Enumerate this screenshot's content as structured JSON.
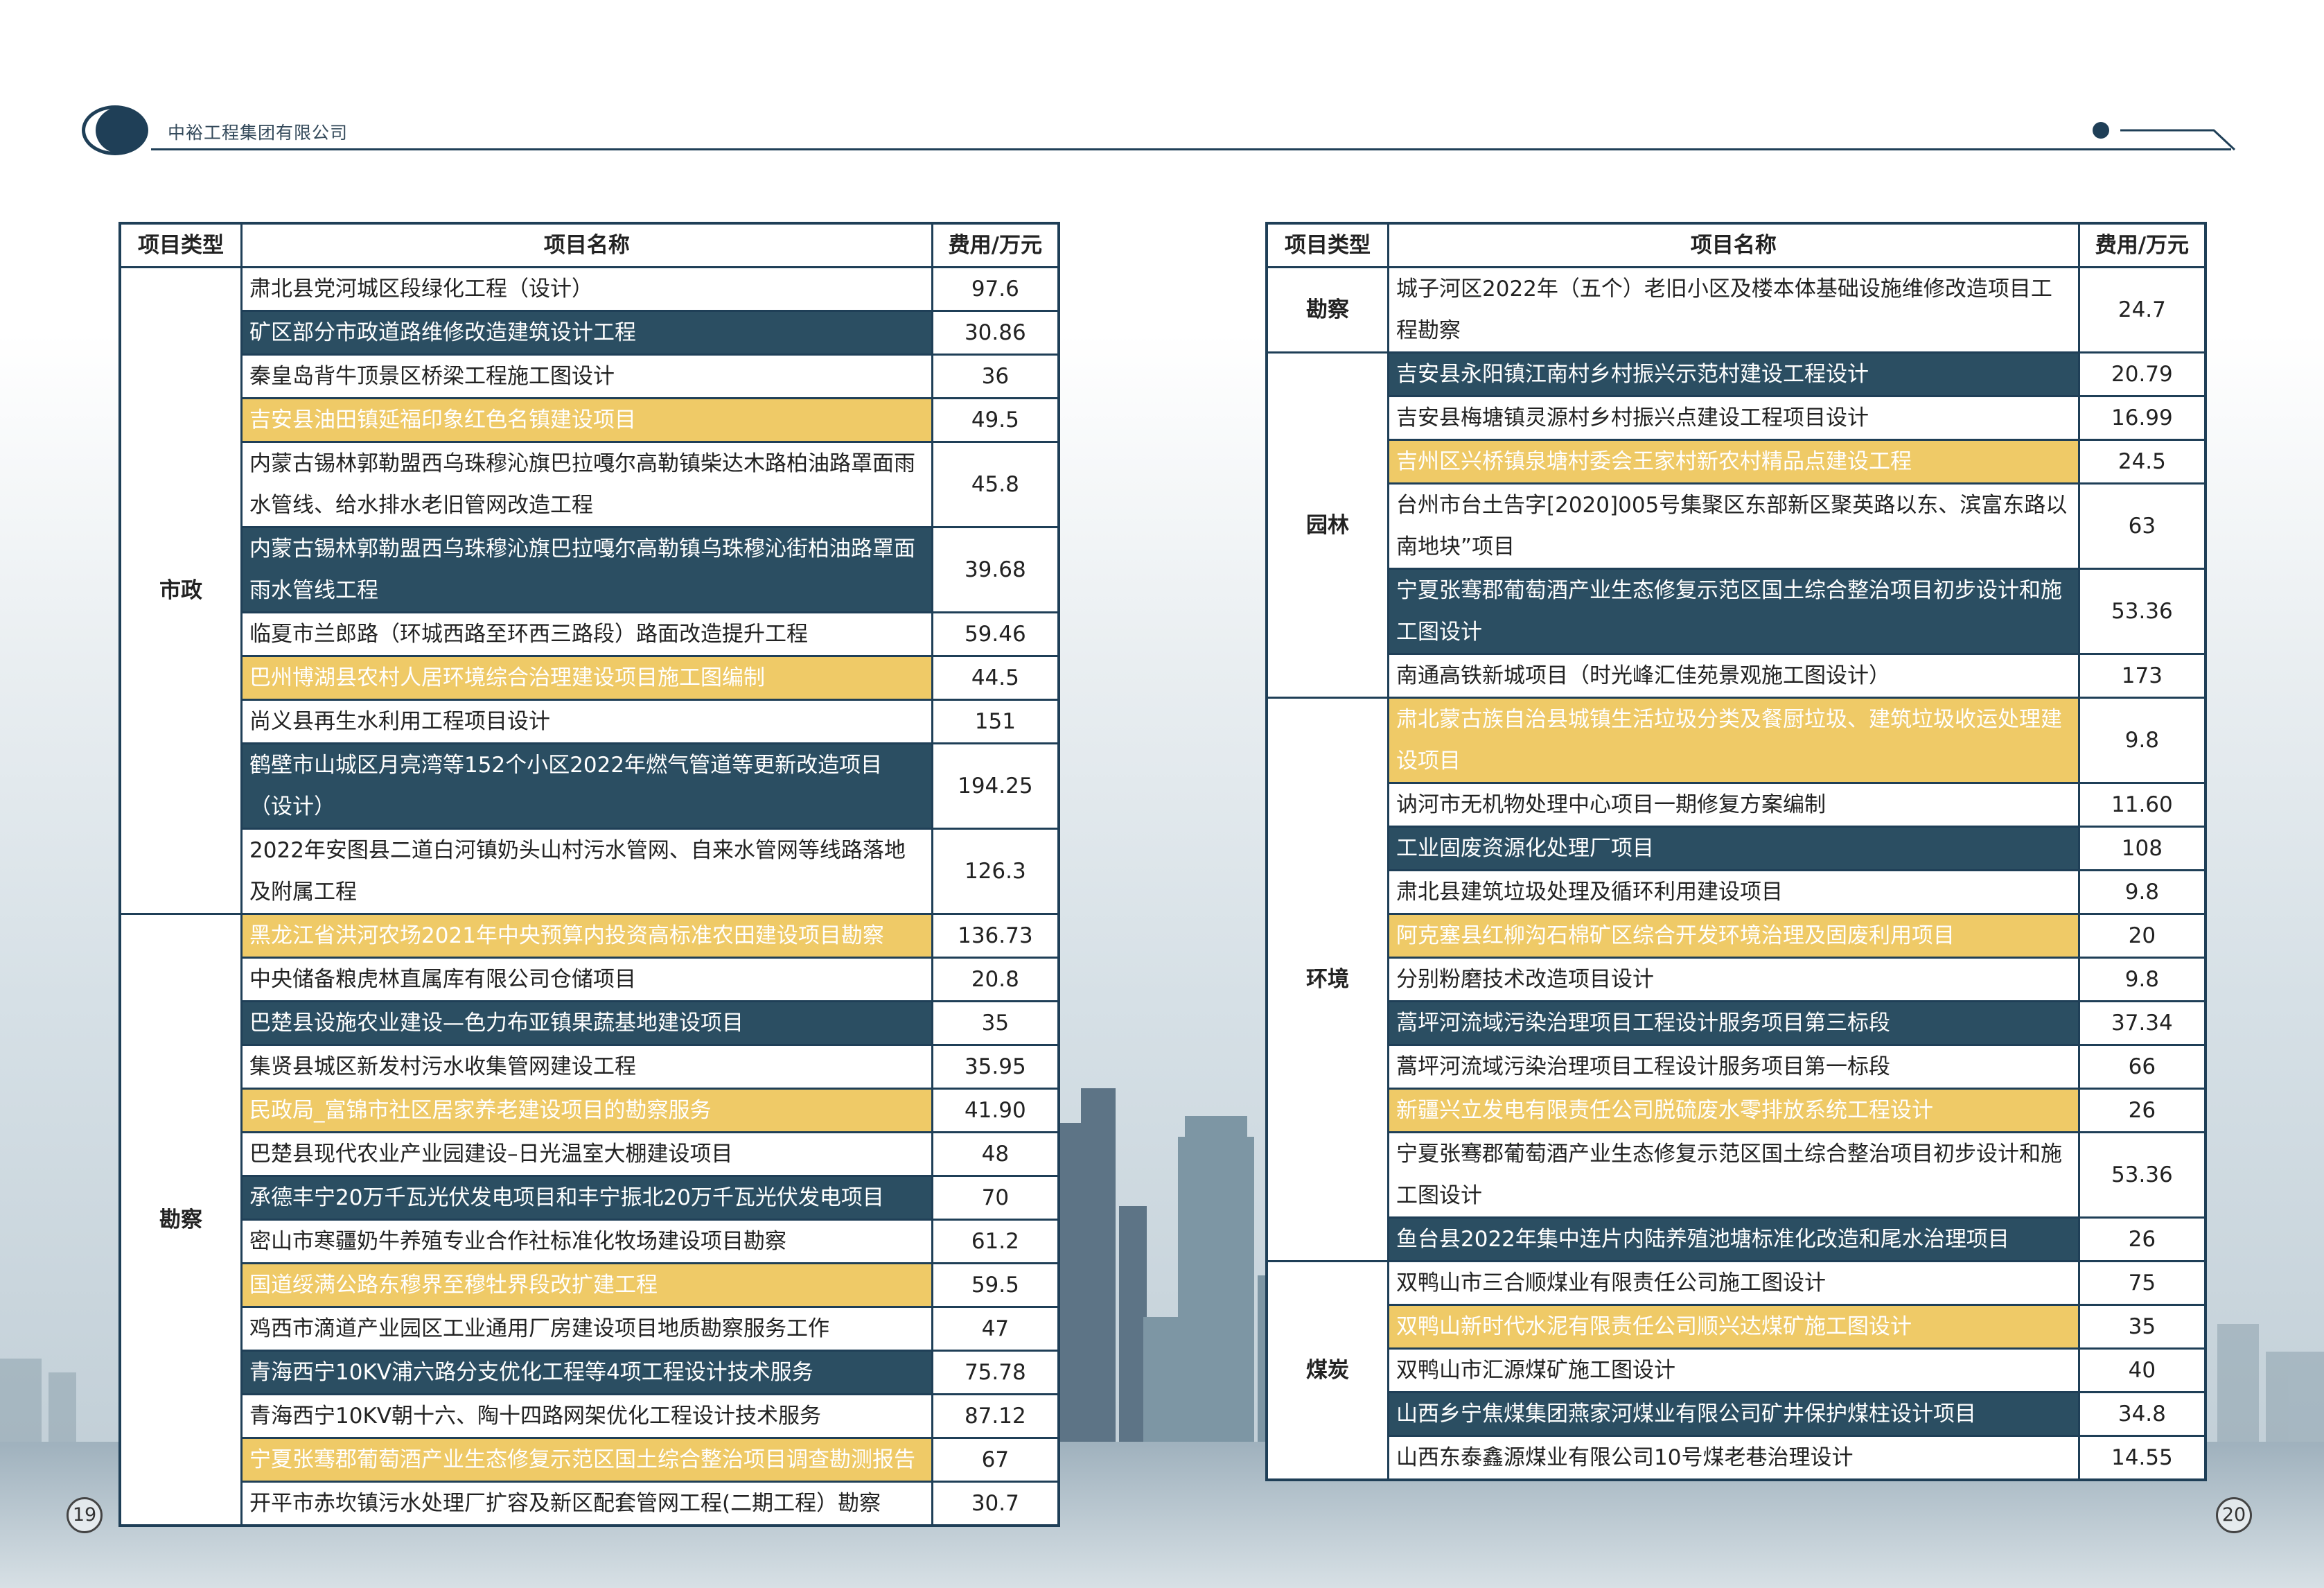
{
  "header": {
    "company": "中裕工程集团有限公司"
  },
  "columns": {
    "type": "项目类型",
    "name": "项目名称",
    "fee": "费用/万元"
  },
  "left_table": {
    "groups": [
      {
        "type": "市政",
        "rows": [
          {
            "name": "肃北县党河城区段绿化工程（设计）",
            "fee": "97.6",
            "hl": "w"
          },
          {
            "name": "矿区部分市政道路维修改造建筑设计工程",
            "fee": "30.86",
            "hl": "d"
          },
          {
            "name": "秦皇岛背牛顶景区桥梁工程施工图设计",
            "fee": "36",
            "hl": "w"
          },
          {
            "name": "吉安县油田镇延福印象红色名镇建设项目",
            "fee": "49.5",
            "hl": "y"
          },
          {
            "name": "内蒙古锡林郭勒盟西乌珠穆沁旗巴拉嘎尔高勒镇柴达木路柏油路罩面雨水管线、给水排水老旧管网改造工程",
            "fee": "45.8",
            "hl": "w"
          },
          {
            "name": "内蒙古锡林郭勒盟西乌珠穆沁旗巴拉嘎尔高勒镇乌珠穆沁街柏油路罩面雨水管线工程",
            "fee": "39.68",
            "hl": "d"
          },
          {
            "name": "临夏市兰郎路（环城西路至环西三路段）路面改造提升工程",
            "fee": "59.46",
            "hl": "w"
          },
          {
            "name": "巴州博湖县农村人居环境综合治理建设项目施工图编制",
            "fee": "44.5",
            "hl": "y"
          },
          {
            "name": "尚义县再生水利用工程项目设计",
            "fee": "151",
            "hl": "w"
          },
          {
            "name": "鹤壁市山城区月亮湾等152个小区2022年燃气管道等更新改造项目（设计）",
            "fee": "194.25",
            "hl": "d"
          },
          {
            "name": "2022年安图县二道白河镇奶头山村污水管网、自来水管网等线路落地及附属工程",
            "fee": "126.3",
            "hl": "w"
          }
        ]
      },
      {
        "type": "勘察",
        "rows": [
          {
            "name": "黑龙江省洪河农场2021年中央预算内投资高标准农田建设项目勘察",
            "fee": "136.73",
            "hl": "y"
          },
          {
            "name": "中央储备粮虎林直属库有限公司仓储项目",
            "fee": "20.8",
            "hl": "w"
          },
          {
            "name": "巴楚县设施农业建设—色力布亚镇果蔬基地建设项目",
            "fee": "35",
            "hl": "d"
          },
          {
            "name": "集贤县城区新发村污水收集管网建设工程",
            "fee": "35.95",
            "hl": "w"
          },
          {
            "name": "民政局_富锦市社区居家养老建设项目的勘察服务",
            "fee": "41.90",
            "hl": "y"
          },
          {
            "name": "巴楚县现代农业产业园建设–日光温室大棚建设项目",
            "fee": "48",
            "hl": "w"
          },
          {
            "name": "承德丰宁20万千瓦光伏发电项目和丰宁振北20万千瓦光伏发电项目",
            "fee": "70",
            "hl": "d"
          },
          {
            "name": "密山市寒疆奶牛养殖专业合作社标准化牧场建设项目勘察",
            "fee": "61.2",
            "hl": "w"
          },
          {
            "name": "国道绥满公路东穆界至穆牡界段改扩建工程",
            "fee": "59.5",
            "hl": "y"
          },
          {
            "name": "鸡西市滴道产业园区工业通用厂房建设项目地质勘察服务工作",
            "fee": "47",
            "hl": "w"
          },
          {
            "name": "青海西宁10KV浦六路分支优化工程等4项工程设计技术服务",
            "fee": "75.78",
            "hl": "d"
          },
          {
            "name": "青海西宁10KV朝十六、陶十四路网架优化工程设计技术服务",
            "fee": "87.12",
            "hl": "w"
          },
          {
            "name": "宁夏张骞郡葡萄酒产业生态修复示范区国土综合整治项目调查勘测报告",
            "fee": "67",
            "hl": "y"
          },
          {
            "name": "开平市赤坎镇污水处理厂扩容及新区配套管网工程(二期工程）勘察",
            "fee": "30.7",
            "hl": "w"
          }
        ]
      }
    ]
  },
  "right_table": {
    "groups": [
      {
        "type": "勘察",
        "rows": [
          {
            "name": "城子河区2022年（五个）老旧小区及楼本体基础设施维修改造项目工程勘察",
            "fee": "24.7",
            "hl": "w"
          }
        ]
      },
      {
        "type": "园林",
        "rows": [
          {
            "name": "吉安县永阳镇江南村乡村振兴示范村建设工程设计",
            "fee": "20.79",
            "hl": "d"
          },
          {
            "name": "吉安县梅塘镇灵源村乡村振兴点建设工程项目设计",
            "fee": "16.99",
            "hl": "w"
          },
          {
            "name": "吉州区兴桥镇泉塘村委会王家村新农村精品点建设工程",
            "fee": "24.5",
            "hl": "y"
          },
          {
            "name": "台州市台土告字[2020]005号集聚区东部新区聚英路以东、滨富东路以南地块”项目",
            "fee": "63",
            "hl": "w"
          },
          {
            "name": "宁夏张骞郡葡萄酒产业生态修复示范区国土综合整治项目初步设计和施工图设计",
            "fee": "53.36",
            "hl": "d"
          },
          {
            "name": "南通高铁新城项目（时光峰汇佳苑景观施工图设计）",
            "fee": "173",
            "hl": "w"
          }
        ]
      },
      {
        "type": "环境",
        "rows": [
          {
            "name": "肃北蒙古族自治县城镇生活垃圾分类及餐厨垃圾、建筑垃圾收运处理建设项目",
            "fee": "9.8",
            "hl": "y"
          },
          {
            "name": "讷河市无机物处理中心项目一期修复方案编制",
            "fee": "11.60",
            "hl": "w"
          },
          {
            "name": "工业固废资源化处理厂项目",
            "fee": "108",
            "hl": "d"
          },
          {
            "name": "肃北县建筑垃圾处理及循环利用建设项目",
            "fee": "9.8",
            "hl": "w"
          },
          {
            "name": "阿克塞县红柳沟石棉矿区综合开发环境治理及固废利用项目",
            "fee": "20",
            "hl": "y"
          },
          {
            "name": "分别粉磨技术改造项目设计",
            "fee": "9.8",
            "hl": "w"
          },
          {
            "name": "蒿坪河流域污染治理项目工程设计服务项目第三标段",
            "fee": "37.34",
            "hl": "d"
          },
          {
            "name": "蒿坪河流域污染治理项目工程设计服务项目第一标段",
            "fee": "66",
            "hl": "w"
          },
          {
            "name": "新疆兴立发电有限责任公司脱硫废水零排放系统工程设计",
            "fee": "26",
            "hl": "y"
          },
          {
            "name": "宁夏张骞郡葡萄酒产业生态修复示范区国土综合整治项目初步设计和施工图设计",
            "fee": "53.36",
            "hl": "w"
          },
          {
            "name": "鱼台县2022年集中连片内陆养殖池塘标准化改造和尾水治理项目",
            "fee": "26",
            "hl": "d"
          }
        ]
      },
      {
        "type": "煤炭",
        "rows": [
          {
            "name": "双鸭山市三合顺煤业有限责任公司施工图设计",
            "fee": "75",
            "hl": "w"
          },
          {
            "name": "双鸭山新时代水泥有限责任公司顺兴达煤矿施工图设计",
            "fee": "35",
            "hl": "y"
          },
          {
            "name": "双鸭山市汇源煤矿施工图设计",
            "fee": "40",
            "hl": "w"
          },
          {
            "name": "山西乡宁焦煤集团燕家河煤业有限公司矿井保护煤柱设计项目",
            "fee": "34.8",
            "hl": "d"
          },
          {
            "name": "山西东泰鑫源煤业有限公司10号煤老巷治理设计",
            "fee": "14.55",
            "hl": "w"
          }
        ]
      }
    ]
  },
  "page_numbers": {
    "left": "19",
    "right": "20"
  },
  "colors": {
    "navy": "#1f3f57",
    "dark_row": "#2b4e62",
    "yellow_row": "#efca67"
  }
}
